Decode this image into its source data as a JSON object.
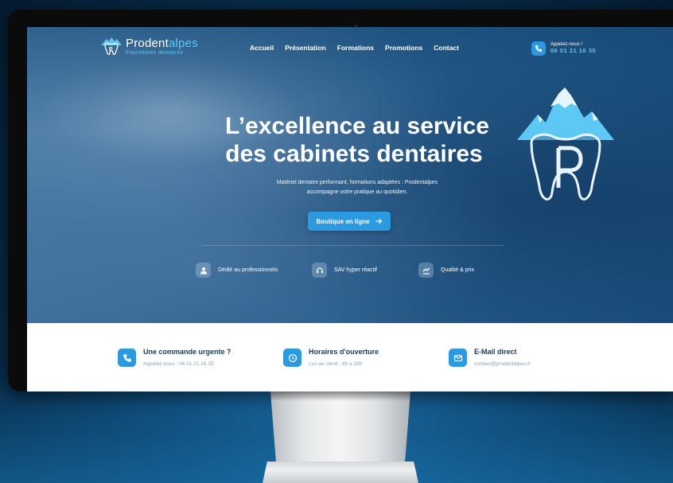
{
  "brand": {
    "name_part1": "Prodent",
    "name_part2": "alpes",
    "tagline": "Fournitures dentaires"
  },
  "nav": {
    "items": [
      "Accueil",
      "Présentation",
      "Formations",
      "Promotions",
      "Contact"
    ]
  },
  "call": {
    "label": "Appelez-nous !",
    "number": "06 01 21 16 35"
  },
  "hero": {
    "title_line1": "L’excellence au service",
    "title_line2": "des cabinets dentaires",
    "subtitle_line1": "Matériel dentaire performant, formations adaptées : Prodentalpes",
    "subtitle_line2": "accompagne votre pratique au quotidien.",
    "cta_label": "Boutique en ligne"
  },
  "features": [
    {
      "label": "Dédié au professionnels",
      "icon": "professional-icon"
    },
    {
      "label": "SAV hyper réactif",
      "icon": "support-icon"
    },
    {
      "label": "Qualité & prix",
      "icon": "quality-icon"
    }
  ],
  "info": [
    {
      "title": "Une commande urgente ?",
      "desc": "Appelez-nous : 06 01 21 16 35",
      "icon": "phone-icon"
    },
    {
      "title": "Horaires d'ouverture",
      "desc": "Lun au Vend : 8h à 19h",
      "icon": "clock-icon"
    },
    {
      "title": "E-Mail direct",
      "desc": "contact@prodentalpes.fr",
      "icon": "mail-icon"
    }
  ],
  "colors": {
    "accent": "#2b9ae0",
    "light_accent": "#5cc8f3",
    "heading_dark": "#1a3a5c"
  }
}
